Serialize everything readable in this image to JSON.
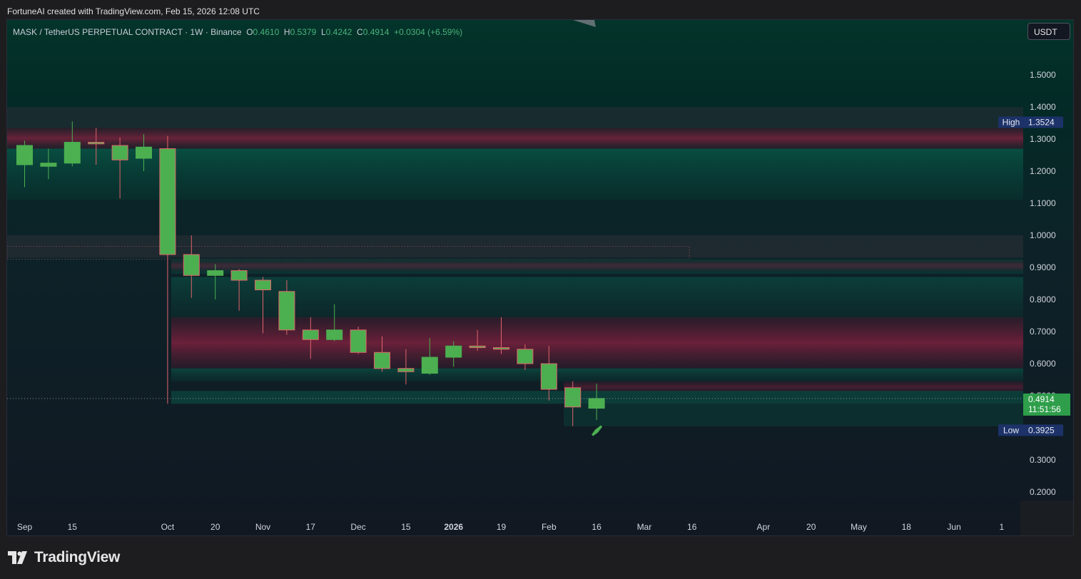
{
  "attribution": "FortuneAI created with TradingView.com, Feb 15, 2026 12:08 UTC",
  "legend": {
    "symbol": "MASK / TetherUS PERPETUAL CONTRACT · 1W · Binance",
    "open_label": "O",
    "open": "0.4610",
    "high_label": "H",
    "high": "0.5379",
    "low_label": "L",
    "low": "0.4242",
    "close_label": "C",
    "close": "0.4914",
    "change": "+0.0304 (+6.59%)"
  },
  "currency_button": "USDT",
  "brand": "TradingView",
  "colors": {
    "up": "#4caf50",
    "down_border": "#e0646a",
    "high_label_bg": "#1c3269",
    "price_label_bg": "#2e9e4a"
  },
  "chart_data": {
    "type": "candlestick",
    "timeframe": "1W",
    "y_ticks": [
      "0.2000",
      "0.3000",
      "0.4000",
      "0.5000",
      "0.6000",
      "0.7000",
      "0.8000",
      "0.9000",
      "1.0000",
      "1.1000",
      "1.2000",
      "1.3000",
      "1.4000",
      "1.5000"
    ],
    "x_ticks": [
      {
        "label": "Sep",
        "bar": 0,
        "bold": false
      },
      {
        "label": "15",
        "bar": 2,
        "bold": false
      },
      {
        "label": "Oct",
        "bar": 6,
        "bold": false
      },
      {
        "label": "20",
        "bar": 8,
        "bold": false
      },
      {
        "label": "Nov",
        "bar": 10,
        "bold": false
      },
      {
        "label": "17",
        "bar": 12,
        "bold": false
      },
      {
        "label": "Dec",
        "bar": 14,
        "bold": false
      },
      {
        "label": "15",
        "bar": 16,
        "bold": false
      },
      {
        "label": "2026",
        "bar": 18,
        "bold": true
      },
      {
        "label": "19",
        "bar": 20,
        "bold": false
      },
      {
        "label": "Feb",
        "bar": 22,
        "bold": false
      },
      {
        "label": "16",
        "bar": 24,
        "bold": false
      },
      {
        "label": "Mar",
        "bar": 26,
        "bold": false
      },
      {
        "label": "16",
        "bar": 28,
        "bold": false
      },
      {
        "label": "Apr",
        "bar": 31,
        "bold": false
      },
      {
        "label": "20",
        "bar": 33,
        "bold": false
      },
      {
        "label": "May",
        "bar": 35,
        "bold": false
      },
      {
        "label": "18",
        "bar": 37,
        "bold": false
      },
      {
        "label": "Jun",
        "bar": 39,
        "bold": false
      },
      {
        "label": "1",
        "bar": 41,
        "bold": false
      }
    ],
    "candles": [
      {
        "o": 1.22,
        "h": 1.295,
        "l": 1.15,
        "c": 1.28
      },
      {
        "o": 1.215,
        "h": 1.27,
        "l": 1.175,
        "c": 1.225
      },
      {
        "o": 1.225,
        "h": 1.355,
        "l": 1.215,
        "c": 1.29
      },
      {
        "o": 1.29,
        "h": 1.335,
        "l": 1.22,
        "c": 1.285
      },
      {
        "o": 1.28,
        "h": 1.305,
        "l": 1.115,
        "c": 1.235
      },
      {
        "o": 1.24,
        "h": 1.315,
        "l": 1.2,
        "c": 1.275
      },
      {
        "o": 1.27,
        "h": 1.31,
        "l": 0.475,
        "c": 0.94
      },
      {
        "o": 0.94,
        "h": 1.0,
        "l": 0.805,
        "c": 0.875
      },
      {
        "o": 0.875,
        "h": 0.91,
        "l": 0.8,
        "c": 0.89
      },
      {
        "o": 0.89,
        "h": 0.895,
        "l": 0.765,
        "c": 0.86
      },
      {
        "o": 0.86,
        "h": 0.87,
        "l": 0.695,
        "c": 0.83
      },
      {
        "o": 0.825,
        "h": 0.86,
        "l": 0.69,
        "c": 0.705
      },
      {
        "o": 0.705,
        "h": 0.745,
        "l": 0.615,
        "c": 0.675
      },
      {
        "o": 0.675,
        "h": 0.785,
        "l": 0.67,
        "c": 0.705
      },
      {
        "o": 0.705,
        "h": 0.715,
        "l": 0.63,
        "c": 0.635
      },
      {
        "o": 0.635,
        "h": 0.685,
        "l": 0.575,
        "c": 0.585
      },
      {
        "o": 0.585,
        "h": 0.645,
        "l": 0.535,
        "c": 0.575
      },
      {
        "o": 0.57,
        "h": 0.68,
        "l": 0.565,
        "c": 0.62
      },
      {
        "o": 0.62,
        "h": 0.67,
        "l": 0.59,
        "c": 0.655
      },
      {
        "o": 0.655,
        "h": 0.705,
        "l": 0.64,
        "c": 0.65
      },
      {
        "o": 0.65,
        "h": 0.745,
        "l": 0.63,
        "c": 0.645
      },
      {
        "o": 0.645,
        "h": 0.66,
        "l": 0.58,
        "c": 0.6
      },
      {
        "o": 0.6,
        "h": 0.655,
        "l": 0.485,
        "c": 0.52
      },
      {
        "o": 0.525,
        "h": 0.545,
        "l": 0.405,
        "c": 0.465
      },
      {
        "o": 0.461,
        "h": 0.5379,
        "l": 0.4242,
        "c": 0.4914
      }
    ],
    "high_marker": {
      "label": "High",
      "value": "1.3524"
    },
    "low_marker": {
      "label": "Low",
      "value": "0.3925"
    },
    "last_price": {
      "value": "0.4914",
      "countdown": "11:51:56"
    }
  }
}
